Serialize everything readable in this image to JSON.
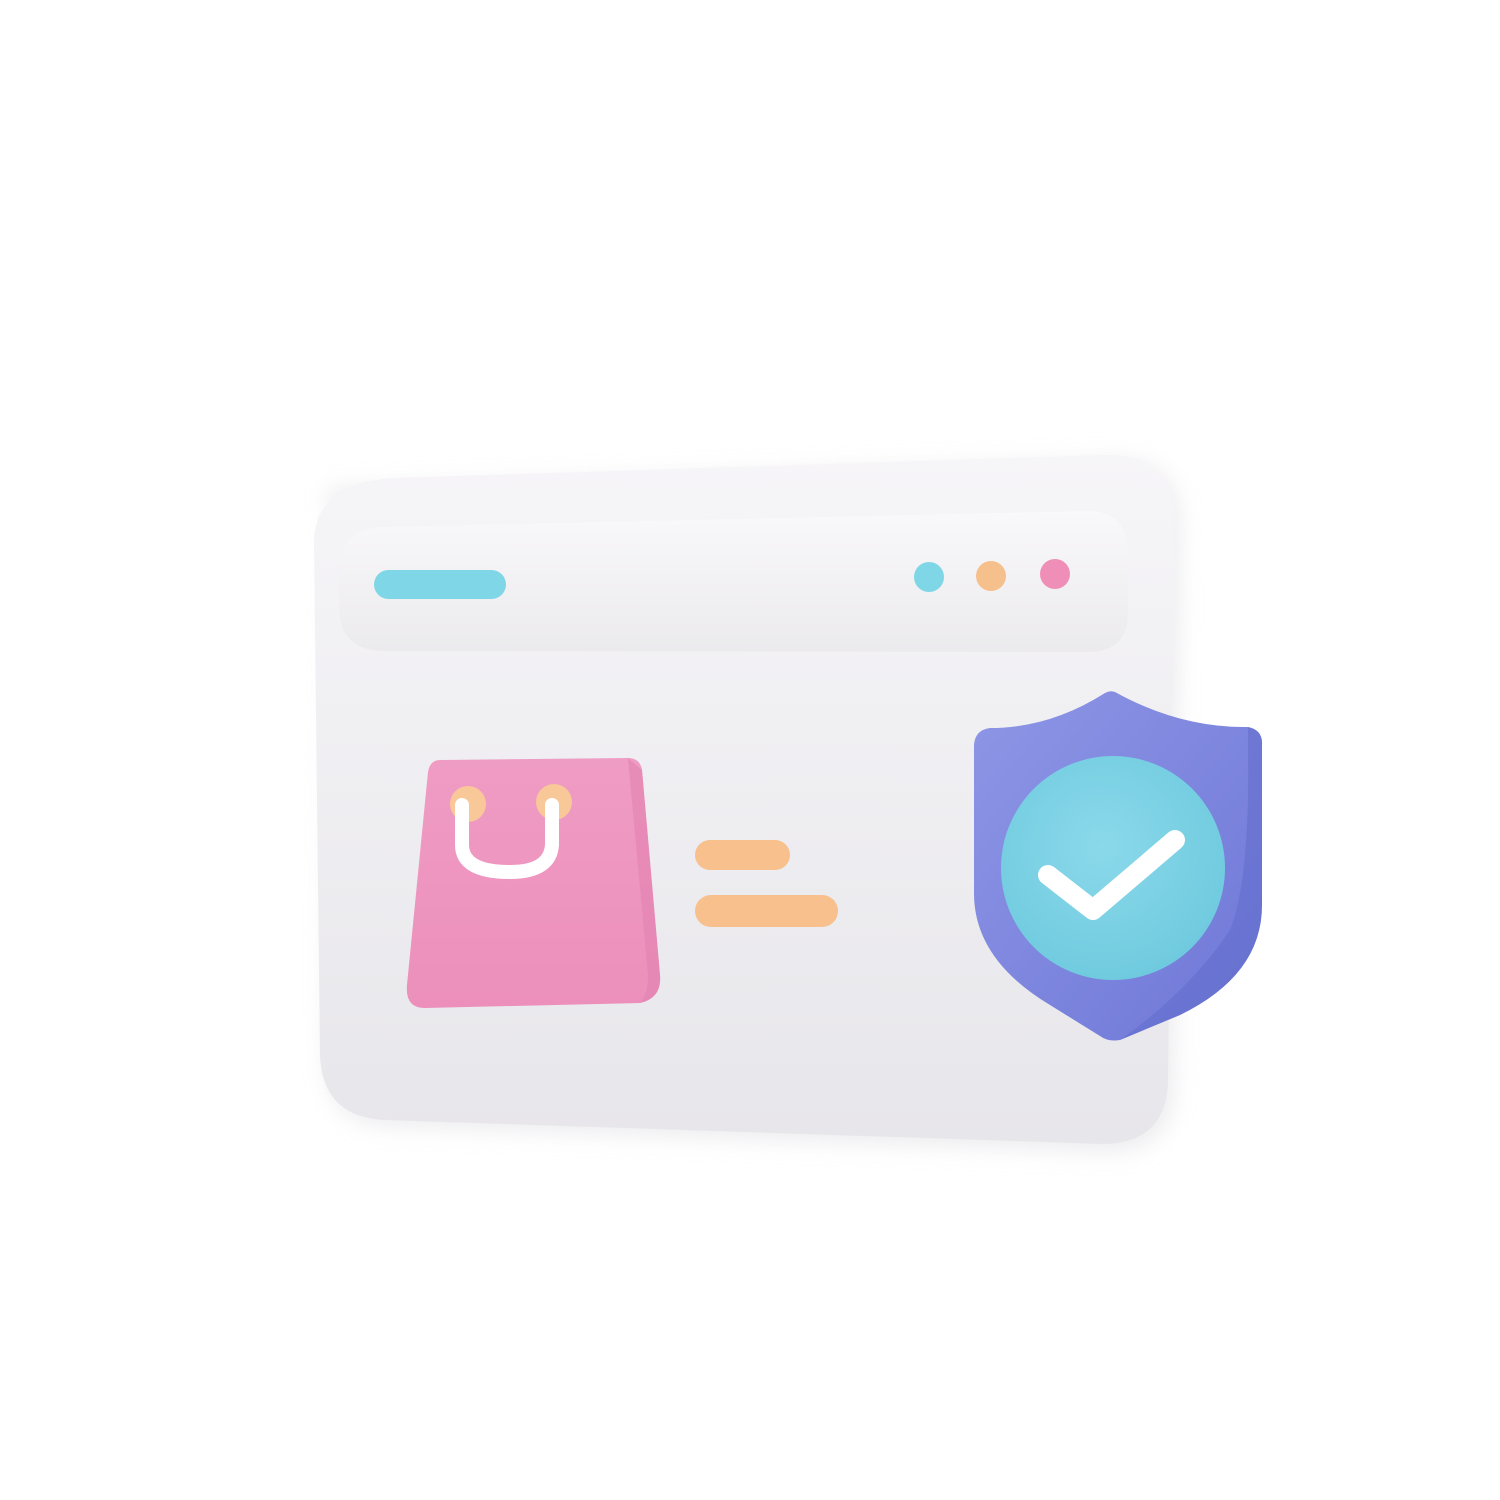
{
  "illustration": {
    "window": {
      "body_color": "#eeedf0",
      "shade_color": "#dcdbe0",
      "toolbar_color": "#f4f3f6",
      "title_bar_color": "#7fd6e6"
    },
    "window_controls": [
      {
        "icon": "dot-icon",
        "color": "#7fd6e6"
      },
      {
        "icon": "dot-icon",
        "color": "#f6c08c"
      },
      {
        "icon": "dot-icon",
        "color": "#ef8fb8"
      }
    ],
    "shopping_bag": {
      "icon": "shopping-bag-icon",
      "color": "#ee9fc6",
      "handle_color": "#ffffff",
      "ring_color": "#f8c898"
    },
    "equals_lines": {
      "icon": "equals-icon",
      "color": "#f7c08d"
    },
    "shield": {
      "icon": "shield-icon",
      "color": "#7f88e0",
      "badge_color": "#7fd3e4",
      "check_icon": "check-icon",
      "check_color": "#ffffff"
    }
  }
}
